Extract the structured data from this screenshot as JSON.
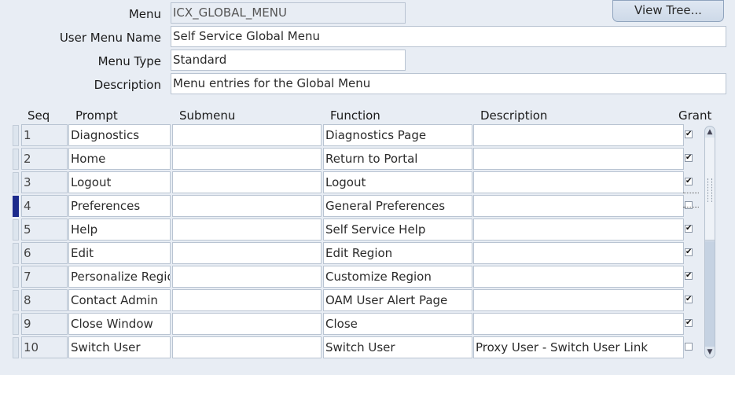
{
  "header": {
    "menu_label": "Menu",
    "menu_value": "ICX_GLOBAL_MENU",
    "user_menu_name_label": "User Menu Name",
    "user_menu_name_value": "Self Service Global Menu",
    "menu_type_label": "Menu Type",
    "menu_type_value": "Standard",
    "description_label": "Description",
    "description_value": "Menu entries for the Global Menu",
    "view_tree_label": "View Tree..."
  },
  "table": {
    "columns": [
      "Seq",
      "Prompt",
      "Submenu",
      "Function",
      "Description",
      "Grant"
    ],
    "rows": [
      {
        "seq": "1",
        "prompt": "Diagnostics",
        "submenu": "",
        "function": "Diagnostics Page",
        "description": "",
        "grant": true
      },
      {
        "seq": "2",
        "prompt": "Home",
        "submenu": "",
        "function": "Return to Portal",
        "description": "",
        "grant": true
      },
      {
        "seq": "3",
        "prompt": "Logout",
        "submenu": "",
        "function": "Logout",
        "description": "",
        "grant": true
      },
      {
        "seq": "4",
        "prompt": "Preferences",
        "submenu": "",
        "function": "General Preferences",
        "description": "",
        "grant": false
      },
      {
        "seq": "5",
        "prompt": "Help",
        "submenu": "",
        "function": "Self Service Help",
        "description": "",
        "grant": true
      },
      {
        "seq": "6",
        "prompt": "Edit",
        "submenu": "",
        "function": "Edit Region",
        "description": "",
        "grant": true
      },
      {
        "seq": "7",
        "prompt": "Personalize Regio",
        "submenu": "",
        "function": "Customize Region",
        "description": "",
        "grant": true
      },
      {
        "seq": "8",
        "prompt": "Contact Admin",
        "submenu": "",
        "function": "OAM User Alert Page",
        "description": "",
        "grant": true
      },
      {
        "seq": "9",
        "prompt": "Close Window",
        "submenu": "",
        "function": "Close",
        "description": "",
        "grant": true
      },
      {
        "seq": "10",
        "prompt": "Switch User",
        "submenu": "",
        "function": "Switch User",
        "description": "Proxy User - Switch User Link",
        "grant": false
      }
    ],
    "current_row": 3
  },
  "icons": {
    "check": "checkmark-icon",
    "scroll_up": "arrow-up-icon",
    "scroll_down": "arrow-down-icon"
  }
}
